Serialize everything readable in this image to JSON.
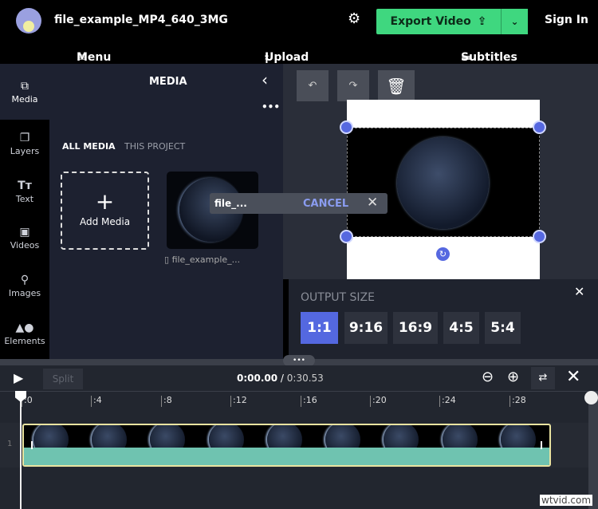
{
  "header": {
    "title": "file_example_MP4_640_3MG",
    "export_label": "Export Video",
    "sign_in": "Sign In",
    "icons": [
      "avatar",
      "gear-icon",
      "share-icon",
      "chevron-down-icon"
    ]
  },
  "nav": {
    "menu": "Menu",
    "upload": "Upload",
    "subtitles": "Subtitles"
  },
  "sidebar": {
    "items": [
      {
        "label": "Media",
        "icon": "media-icon",
        "active": true
      },
      {
        "label": "Layers",
        "icon": "layers-icon"
      },
      {
        "label": "Text",
        "icon": "text-icon"
      },
      {
        "label": "Videos",
        "icon": "videos-icon"
      },
      {
        "label": "Images",
        "icon": "images-icon"
      },
      {
        "label": "Elements",
        "icon": "elements-icon"
      }
    ]
  },
  "media_panel": {
    "title": "MEDIA",
    "tabs": [
      "ALL MEDIA",
      "THIS PROJECT"
    ],
    "add_media": "Add Media",
    "file_caption": "file_example_...",
    "toast": {
      "text": "file_...",
      "cancel": "CANCEL"
    }
  },
  "output_size": {
    "label": "OUTPUT SIZE",
    "options": [
      "1:1",
      "9:16",
      "16:9",
      "4:5",
      "5:4"
    ],
    "selected": "1:1",
    "accent": "#5468e0"
  },
  "timeline": {
    "split": "Split",
    "current_time": "0:00.00",
    "separator": " / ",
    "duration": "0:30.53",
    "ticks": [
      ":0",
      ":4",
      ":8",
      ":12",
      ":16",
      ":20",
      ":24",
      ":28"
    ],
    "track_number": "1",
    "clip_colors": {
      "border": "#e9e3a0",
      "audio": "#6fc3b0"
    }
  },
  "watermark": "wtvid.com",
  "colors": {
    "export": "#3fd77f",
    "accent": "#5468e0"
  }
}
